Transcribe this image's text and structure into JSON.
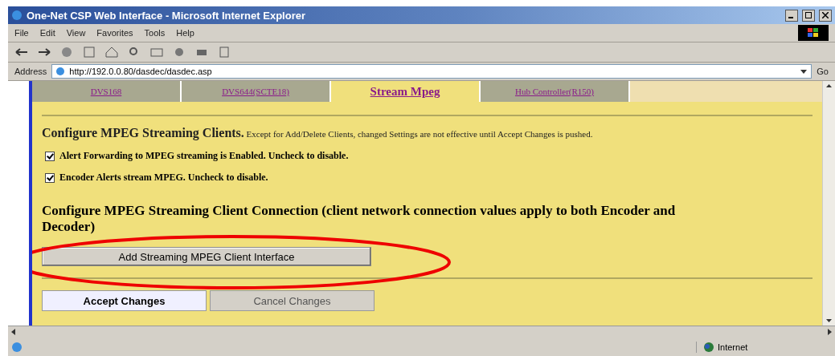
{
  "window": {
    "title": "One-Net CSP Web Interface - Microsoft Internet Explorer"
  },
  "menu": [
    "File",
    "Edit",
    "View",
    "Favorites",
    "Tools",
    "Help"
  ],
  "address": {
    "label": "Address",
    "value": "http://192.0.0.80/dasdec/dasdec.asp",
    "go": "Go"
  },
  "tabs": [
    {
      "label": "DVS168",
      "selected": false
    },
    {
      "label": "DVS644(SCTE18)",
      "selected": false
    },
    {
      "label": "Stream Mpeg",
      "selected": true
    },
    {
      "label": "Hub Controller(R150)",
      "selected": false
    }
  ],
  "section1": {
    "heading": "Configure MPEG Streaming Clients.",
    "note": "Except for Add/Delete Clients, changed Settings are not effective until Accept Changes is pushed."
  },
  "options": [
    {
      "label": "Alert Forwarding to MPEG streaming is Enabled. Uncheck to disable.",
      "checked": true
    },
    {
      "label": "Encoder Alerts stream MPEG. Uncheck to disable.",
      "checked": true
    }
  ],
  "section2": {
    "heading": "Configure MPEG Streaming Client Connection (client network connection values apply to both Encoder and Decoder)"
  },
  "add_button": "Add Streaming MPEG Client Interface",
  "actions": [
    {
      "label": "Accept Changes",
      "selected": true
    },
    {
      "label": "Cancel Changes",
      "selected": false
    }
  ],
  "status_bar": {
    "zone": "Internet"
  }
}
